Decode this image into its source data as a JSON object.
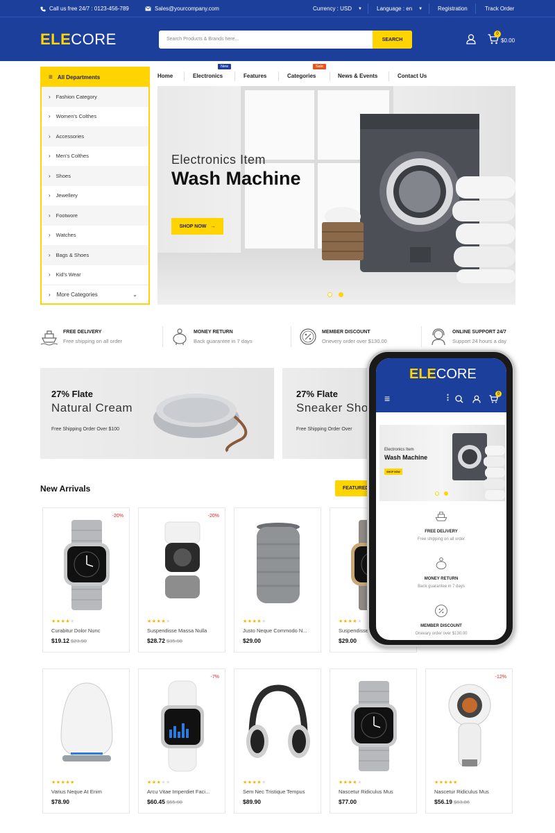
{
  "topbar": {
    "phone": "Call us free 24/7 : 0123-456-789",
    "email": "Sales@yourcompany.com",
    "currency": "Currency : USD",
    "language": "Language : en",
    "registration": "Registration",
    "track": "Track Order"
  },
  "header": {
    "logo_accent": "ELE",
    "logo_rest": "CORE",
    "search_placeholder": "Search Products & Brands here...",
    "search_button": "SEARCH",
    "cart_count": "0",
    "cart_total": "$0.00"
  },
  "departments": {
    "title": "All Departments",
    "items": [
      "Fashion Category",
      "Women's Colthes",
      "Accessories",
      "Men's Colthes",
      "Shoes",
      "Jewellery",
      "Footwore",
      "Watches",
      "Bags & Shoes",
      "Kid's Wear"
    ],
    "more": "More Categories"
  },
  "nav": {
    "items": [
      "Home",
      "Electronics",
      "Features",
      "Categories",
      "News & Events",
      "Contact Us"
    ],
    "new_tag": "New",
    "sale_tag": "Sale"
  },
  "hero": {
    "subtitle": "Electronics Item",
    "title": "Wash Machine",
    "button": "SHOP NOW"
  },
  "features": [
    {
      "title": "FREE DELIVERY",
      "sub": "Free shipping on all order"
    },
    {
      "title": "MONEY RETURN",
      "sub": "Back guarantee in 7 days"
    },
    {
      "title": "MEMBER DISCOUNT",
      "sub": "Onevery order over $130.00"
    },
    {
      "title": "ONLINE SUPPORT 24/7",
      "sub": "Support 24 hours a day"
    }
  ],
  "banners": [
    {
      "line1": "27% Flate",
      "line2": "Natural Cream",
      "line3": "Free Shipping Order Over $100"
    },
    {
      "line1": "27% Flate",
      "line2": "Sneaker Sho",
      "line3": "Free Shipping Order Over"
    }
  ],
  "new_arrivals": {
    "title": "New Arrivals",
    "featured_button": "FEATURED",
    "row1": [
      {
        "discount": "-20%",
        "name": "Curabitur Dolor Nunc",
        "price": "$19.12",
        "old": "$23.90",
        "rating": 4
      },
      {
        "discount": "-20%",
        "name": "Suspendisse Massa Nulla",
        "price": "$28.72",
        "old": "$35.90",
        "rating": 4
      },
      {
        "discount": "",
        "name": "Justo Neque Commodo N...",
        "price": "$29.00",
        "old": "",
        "rating": 4
      },
      {
        "discount": "",
        "name": "Suspendisse",
        "price": "$29.00",
        "old": "",
        "rating": 4
      }
    ],
    "row2": [
      {
        "discount": "",
        "name": "Varius Neque At Enim",
        "price": "$78.90",
        "old": "",
        "rating": 5
      },
      {
        "discount": "-7%",
        "name": "Arcu Vitae Imperdiet Faci...",
        "price": "$60.45",
        "old": "$65.00",
        "rating": 3
      },
      {
        "discount": "",
        "name": "Sem Nec Tristique Tempus",
        "price": "$89.90",
        "old": "",
        "rating": 4
      },
      {
        "discount": "",
        "name": "Nascetur Ridiculus Mus",
        "price": "$77.00",
        "old": "",
        "rating": 4
      },
      {
        "discount": "-12%",
        "name": "Nascetur Ridiculus Mus",
        "price": "$56.19",
        "old": "$63.86",
        "rating": 5
      }
    ]
  },
  "mobile": {
    "logo_accent": "ELE",
    "logo_rest": "CORE",
    "cart_count": "0",
    "hero_sub": "Electronics Item",
    "hero_title": "Wash Machine",
    "hero_button": "SHOP NOW",
    "features": [
      {
        "title": "FREE DELIVERY",
        "sub": "Free shipping on all order"
      },
      {
        "title": "MONEY RETURN",
        "sub": "Back guarantee in 7 days"
      },
      {
        "title": "MEMBER DISCOUNT",
        "sub": "Onevary order over $130.00"
      }
    ]
  },
  "colors": {
    "brand_blue": "#1d3f9c",
    "accent_yellow": "#ffd400",
    "sale_red": "#e5231f"
  }
}
